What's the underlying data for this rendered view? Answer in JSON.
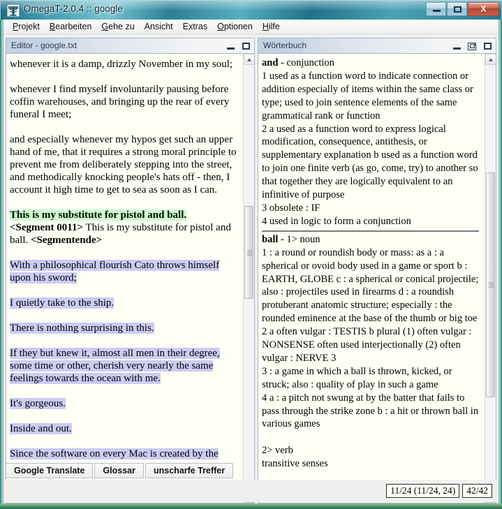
{
  "window": {
    "title": "OmegaT-2.0.4 :: google",
    "icon": "omegat-logo-icon",
    "buttons": {
      "minimize": "minimize-button",
      "maximize": "maximize-button",
      "close": "X"
    }
  },
  "menubar": {
    "items": [
      {
        "label": "Projekt",
        "mnemonic": "P"
      },
      {
        "label": "Bearbeiten",
        "mnemonic": "B"
      },
      {
        "label": "Gehe zu",
        "mnemonic": "G"
      },
      {
        "label": "Ansicht",
        "mnemonic": "A"
      },
      {
        "label": "Extras",
        "mnemonic": "E"
      },
      {
        "label": "Optionen",
        "mnemonic": "O"
      },
      {
        "label": "Hilfe",
        "mnemonic": "H"
      }
    ]
  },
  "editor_panel": {
    "title": "Editor - google.txt",
    "paragraphs": [
      {
        "style": "plain",
        "text": "whenever it is a damp, drizzly November in my soul;"
      },
      {
        "style": "plain",
        "text": "whenever I find myself involuntarily pausing before coffin warehouses, and bringing up the rear of every funeral I meet;"
      },
      {
        "style": "plain",
        "text": "and especially whenever my hypos get such an upper hand of me, that it requires a strong moral principle to prevent me from deliberately stepping into the street, and methodically knocking people's hats off - then, I account it high time to get to sea as soon as I can."
      }
    ],
    "active_segment": {
      "source": "This is my substitute for pistol and ball.",
      "tag_open": "<Segment 0011>",
      "target": " This is my substitute for pistol and ball. ",
      "tag_close": "<Segmentende>"
    },
    "translated_segments": [
      "With a philosophical flourish Cato throws himself upon his sword;",
      "I quietly take to the ship.",
      "There is nothing surprising in this.",
      "If they but knew it, almost all men in their degree, some time or other, cherish very nearly the same feelings towards the ocean with me.",
      "It's gorgeous.",
      "Inside and out.",
      "Since the software on every Mac is created by the"
    ]
  },
  "dictionary_panel": {
    "title": "Wörterbuch",
    "entries": [
      {
        "headword": "and",
        "pos": "- conjunction",
        "lines": [
          "1 used as a function word to indicate connection or addition especially of items within the same class or type; used to join sentence elements of the same grammatical rank or function",
          "2 a used as a function word to express logical modification, consequence, antithesis, or supplementary explanation b used as a function word to join one finite verb (as go, come, try) to another so that together they are logically equivalent to an infinitive of purpose",
          "3 obsolete : IF",
          "4 used in logic to form a conjunction"
        ]
      },
      {
        "headword": "ball",
        "pos": "- 1> noun",
        "lines": [
          "1 : a round or roundish body or mass: as a : a spherical or ovoid body used in a game or sport b : EARTH, GLOBE c : a spherical or conical projectile; also : projectiles used in firearms d : a roundish protuberant anatomic structure; especially : the rounded eminence at the base of the thumb or big toe",
          "2 a often vulgar : TESTIS b plural (1) often vulgar : NONSENSE often used interjectionally (2) often vulgar : NERVE 3",
          "3 : a game in which a ball is thrown, kicked, or struck; also : quality of play in such a game",
          "4 a : a pitch not swung at by the batter that fails to pass through the strike zone b : a hit or thrown ball in various games"
        ],
        "subsense_blank": "",
        "subsense": "2> verb",
        "subsense_lines": [
          "transitive senses"
        ]
      }
    ]
  },
  "tabs": [
    {
      "label": "Google Translate"
    },
    {
      "label": "Glossar"
    },
    {
      "label": "unscharfe Treffer"
    }
  ],
  "statusbar": {
    "segment_counter": "11/24 (11/24, 24)",
    "progress_counter": "42/42"
  },
  "colors": {
    "highlight_source": "#ccffcc",
    "highlight_translated": "#ccccf5",
    "panel_background": "#fffff5",
    "frame_accent": "#2e8fa8"
  }
}
